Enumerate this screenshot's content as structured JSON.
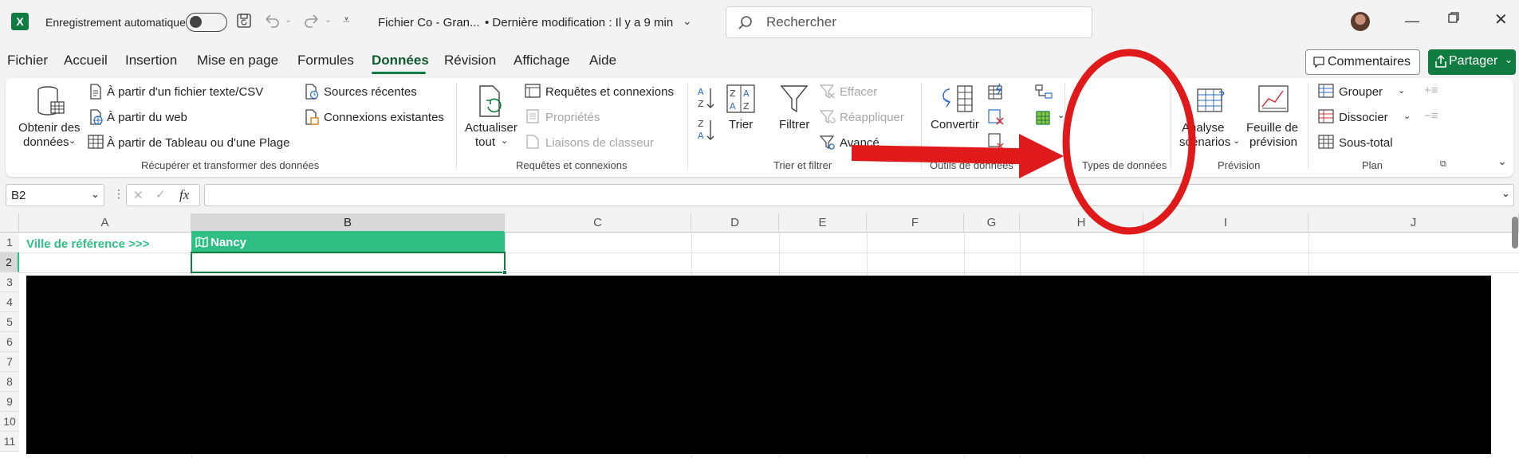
{
  "titlebar": {
    "autosave_label": "Enregistrement automatique",
    "file_name": "Fichier Co - Gran...",
    "last_modified": "• Dernière modification : Il y a 9 min",
    "search_placeholder": "Rechercher"
  },
  "menu": {
    "items": [
      "Fichier",
      "Accueil",
      "Insertion",
      "Mise en page",
      "Formules",
      "Données",
      "Révision",
      "Affichage",
      "Aide"
    ],
    "active": "Données",
    "comments_label": "Commentaires",
    "share_label": "Partager"
  },
  "ribbon": {
    "get_data": {
      "label_line1": "Obtenir des",
      "label_line2": "données"
    },
    "from_text_csv": "À partir d'un fichier texte/CSV",
    "from_web": "À partir du web",
    "from_table": "À partir de Tableau ou d'une Plage",
    "recent_sources": "Sources récentes",
    "existing_connections": "Connexions existantes",
    "group_get_transform": "Récupérer et transformer des données",
    "refresh_all": {
      "label_line1": "Actualiser",
      "label_line2": "tout"
    },
    "queries_connections": "Requêtes et connexions",
    "properties": "Propriétés",
    "workbook_links": "Liaisons de classeur",
    "group_queries": "Requêtes et connexions",
    "sort": "Trier",
    "filter": "Filtrer",
    "clear": "Effacer",
    "reapply": "Réappliquer",
    "advanced": "Avancé",
    "group_sort_filter": "Trier et filtrer",
    "convert": "Convertir",
    "group_data_tools": "Outils de données",
    "group_data_types": "Types de données",
    "what_if": {
      "label_line1": "Analyse",
      "label_line2": "scénarios"
    },
    "forecast_sheet": {
      "label_line1": "Feuille de",
      "label_line2": "prévision"
    },
    "group_forecast": "Prévision",
    "group": "Grouper",
    "ungroup": "Dissocier",
    "subtotal": "Sous-total",
    "group_outline": "Plan"
  },
  "formula_bar": {
    "name_box": "B2",
    "fx": "fx",
    "value": ""
  },
  "sheet": {
    "columns": [
      "A",
      "B",
      "C",
      "D",
      "E",
      "F",
      "G",
      "H",
      "I",
      "J"
    ],
    "rows": [
      "1",
      "2",
      "3",
      "4",
      "5",
      "6",
      "7",
      "8",
      "9",
      "10",
      "11"
    ],
    "cells": {
      "A1": "Ville de référence >>>",
      "B1": "Nancy"
    },
    "accent_color": "#2fbf84",
    "header_selected_color": "#d9d9d9"
  },
  "annotation": {
    "color": "#e0191b"
  }
}
